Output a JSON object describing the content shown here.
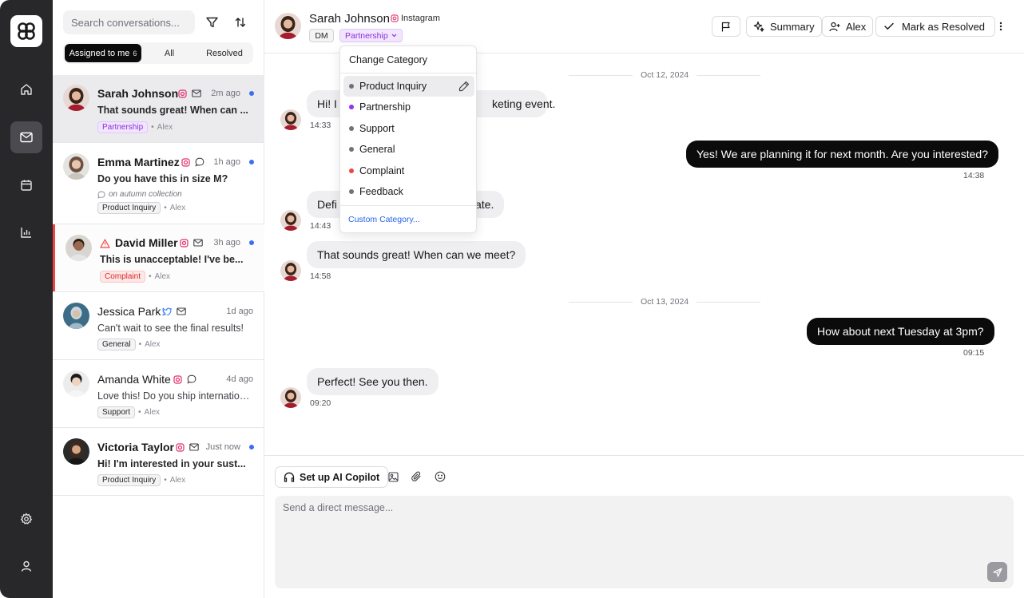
{
  "rail": {
    "logo": "app-logo",
    "nav": [
      "home-icon",
      "mail-icon",
      "calendar-icon",
      "chart-icon"
    ],
    "bottom": [
      "settings-icon",
      "user-icon"
    ],
    "active": "mail-icon"
  },
  "list": {
    "search_placeholder": "Search conversations...",
    "tabs": [
      {
        "label": "Assigned to me",
        "count": "6",
        "active": true
      },
      {
        "label": "All",
        "count": "",
        "active": false
      },
      {
        "label": "Resolved",
        "count": "",
        "active": false
      }
    ],
    "conversations": [
      {
        "name": "Sarah Johnson",
        "channels": [
          "instagram-icon",
          "mail-icon"
        ],
        "time": "2m ago",
        "unread": true,
        "preview": "That sounds great! When can ...",
        "note": "",
        "tag": "Partnership",
        "assignee": "Alex",
        "selected": true,
        "alert": false
      },
      {
        "name": "Emma Martinez",
        "channels": [
          "instagram-icon",
          "chat-icon"
        ],
        "time": "1h ago",
        "unread": true,
        "preview": "Do you have this in size M?",
        "note": "on autumn collection",
        "tag": "Product Inquiry",
        "assignee": "Alex",
        "selected": false,
        "alert": false
      },
      {
        "name": "David Miller",
        "channels": [
          "instagram-icon",
          "mail-icon"
        ],
        "time": "3h ago",
        "unread": true,
        "preview": "This is unacceptable! I've be...",
        "note": "",
        "tag": "Complaint",
        "assignee": "Alex",
        "selected": false,
        "alert": true
      },
      {
        "name": "Jessica Park",
        "channels": [
          "twitter-icon",
          "mail-icon"
        ],
        "time": "1d ago",
        "unread": false,
        "preview": "Can't wait to see the final results!",
        "note": "",
        "tag": "General",
        "assignee": "Alex",
        "selected": false,
        "alert": false
      },
      {
        "name": "Amanda White",
        "channels": [
          "instagram-icon",
          "chat-icon"
        ],
        "time": "4d ago",
        "unread": false,
        "preview": "Love this! Do you ship internationa...",
        "note": "",
        "tag": "Support",
        "assignee": "Alex",
        "selected": false,
        "alert": false
      },
      {
        "name": "Victoria Taylor",
        "channels": [
          "instagram-icon",
          "mail-icon"
        ],
        "time": "Just now",
        "unread": true,
        "preview": "Hi! I'm interested in your sust...",
        "note": "",
        "tag": "Product Inquiry",
        "assignee": "Alex",
        "selected": false,
        "alert": false
      }
    ]
  },
  "header": {
    "name": "Sarah Johnson",
    "channel": "Instagram",
    "type_badge": "DM",
    "category_badge": "Partnership",
    "buttons": {
      "summary": "Summary",
      "assignee": "Alex",
      "resolve": "Mark as Resolved"
    }
  },
  "chat": {
    "dates": [
      "Oct 12, 2024",
      "Oct 13, 2024"
    ],
    "messages": [
      {
        "dir": "in",
        "text": "Hi! I",
        "hidden_tail": "keting event.",
        "time": "14:33"
      },
      {
        "dir": "out",
        "text": "Yes! We are planning it for next month. Are you interested?",
        "time": "14:38"
      },
      {
        "dir": "in",
        "text": "Defi",
        "hidden_tail": "ate.",
        "time": "14:43"
      },
      {
        "dir": "in",
        "text": "That sounds great! When can we meet?",
        "time": "14:58"
      },
      {
        "dir": "out",
        "text": "How about next Tuesday at 3pm?",
        "time": "09:15"
      },
      {
        "dir": "in",
        "text": "Perfect! See you then.",
        "time": "09:20"
      }
    ]
  },
  "dropdown": {
    "title": "Change Category",
    "items": [
      {
        "label": "Product Inquiry",
        "color": "#71717a",
        "hover": true
      },
      {
        "label": "Partnership",
        "color": "#9333ea",
        "hover": false
      },
      {
        "label": "Support",
        "color": "#71717a",
        "hover": false
      },
      {
        "label": "General",
        "color": "#71717a",
        "hover": false
      },
      {
        "label": "Complaint",
        "color": "#ef4444",
        "hover": false
      },
      {
        "label": "Feedback",
        "color": "#71717a",
        "hover": false
      }
    ],
    "custom": "Custom Category..."
  },
  "composer": {
    "copilot": "Set up AI Copilot",
    "placeholder": "Send a direct message..."
  },
  "colors": {
    "accent_blue": "#3b6ef5",
    "partnership": "#9333ea",
    "complaint": "#ef4444"
  }
}
